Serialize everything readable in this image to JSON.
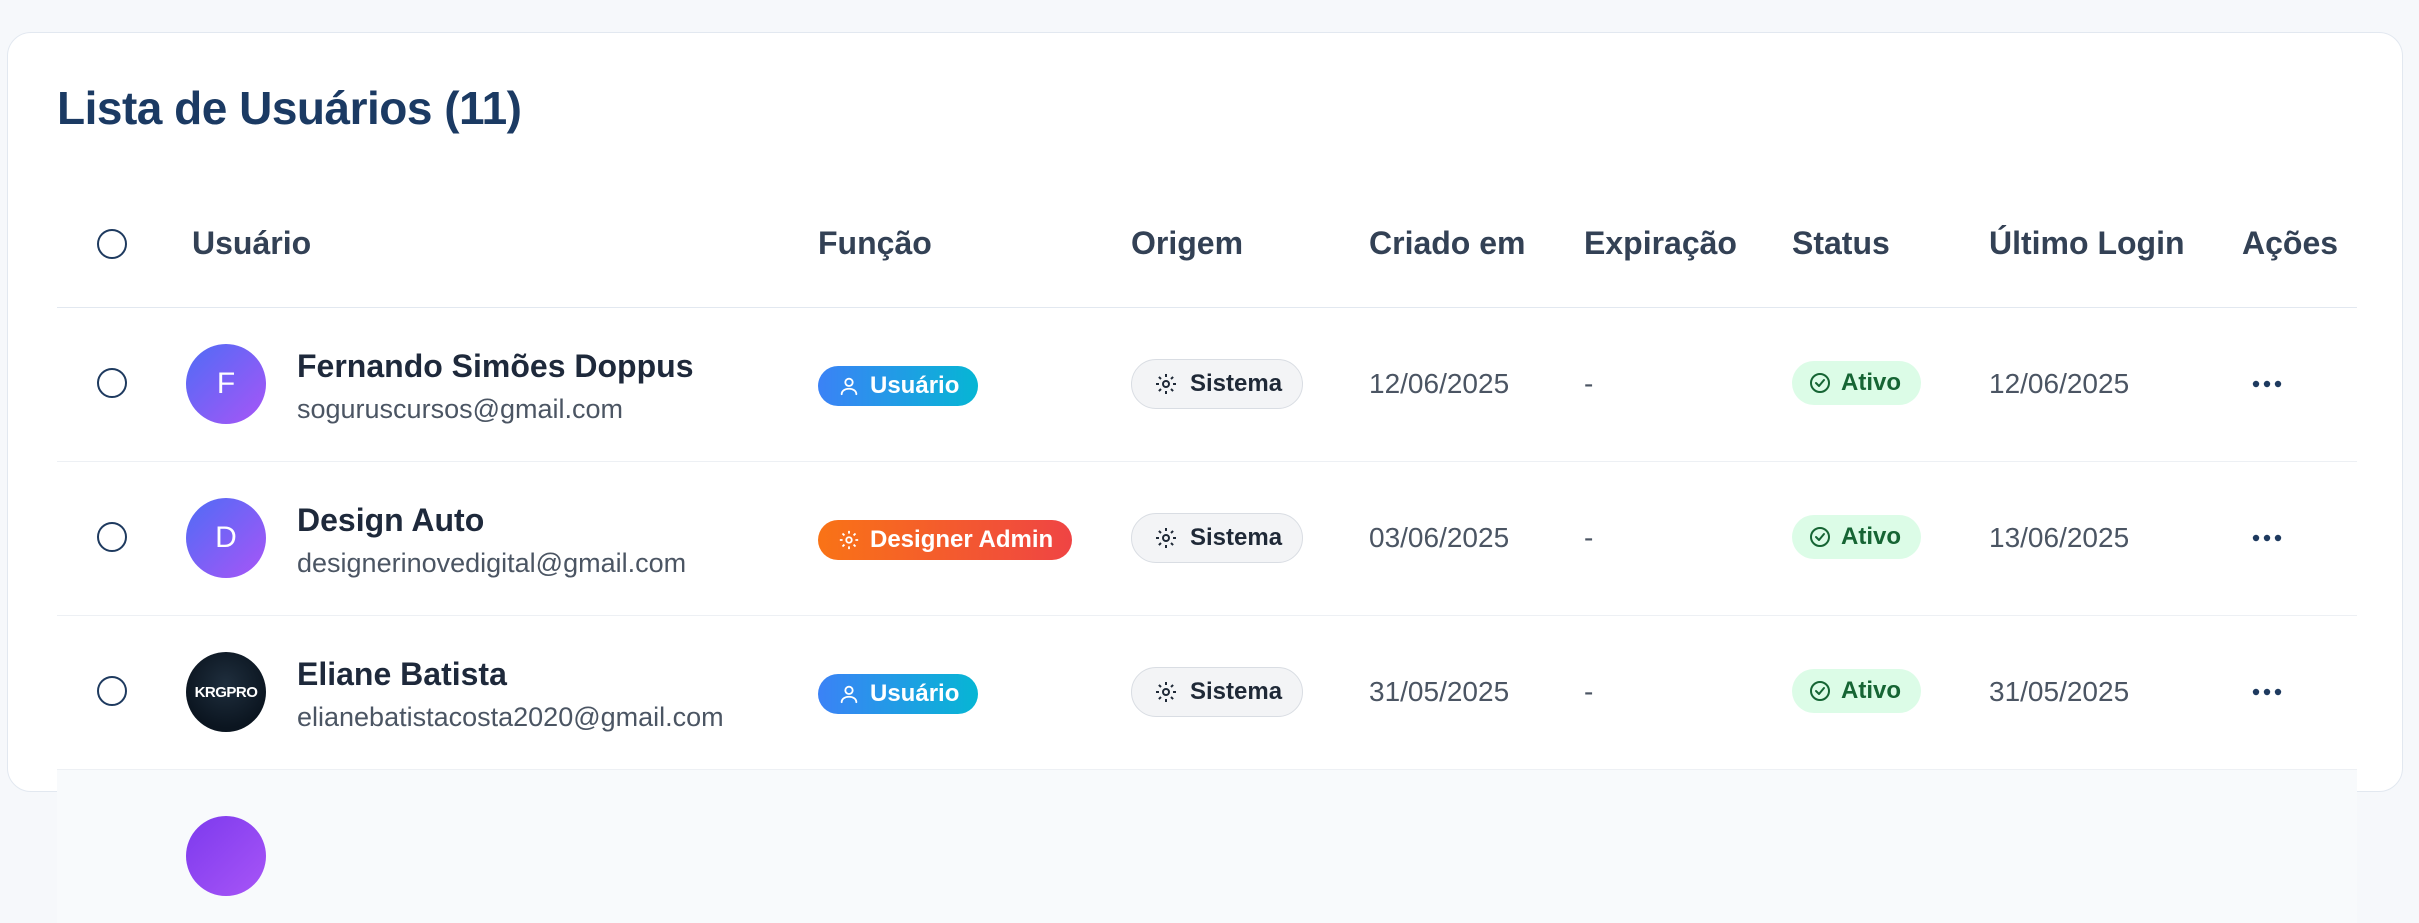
{
  "page": {
    "title": "Lista de Usuários (11)"
  },
  "table": {
    "columns": {
      "user": "Usuário",
      "role": "Função",
      "origin": "Origem",
      "created": "Criado em",
      "expiration": "Expiração",
      "status": "Status",
      "last_login": "Último Login",
      "actions": "Ações"
    },
    "rows": [
      {
        "avatar": "F",
        "name": "Fernando Simões Doppus",
        "email": "soguruscursos@gmail.com",
        "role": "Usuário",
        "role_icon": "user-icon",
        "origin": "Sistema",
        "created": "12/06/2025",
        "expiration": "-",
        "status": "Ativo",
        "last_login": "12/06/2025"
      },
      {
        "avatar": "D",
        "name": "Design Auto",
        "email": "designerinovedigital@gmail.com",
        "role": "Designer Admin",
        "role_icon": "gear-icon",
        "origin": "Sistema",
        "created": "03/06/2025",
        "expiration": "-",
        "status": "Ativo",
        "last_login": "13/06/2025"
      },
      {
        "avatar": "KRGPRO",
        "name": "Eliane Batista",
        "email": "elianebatistacosta2020@gmail.com",
        "role": "Usuário",
        "role_icon": "user-icon",
        "origin": "Sistema",
        "created": "31/05/2025",
        "expiration": "-",
        "status": "Ativo",
        "last_login": "31/05/2025"
      }
    ]
  },
  "colors": {
    "title": "#1b3a63",
    "user_badge": "#3b82f6",
    "admin_badge": "#f97316",
    "status_bg": "#dcfce7",
    "status_text": "#166534"
  }
}
